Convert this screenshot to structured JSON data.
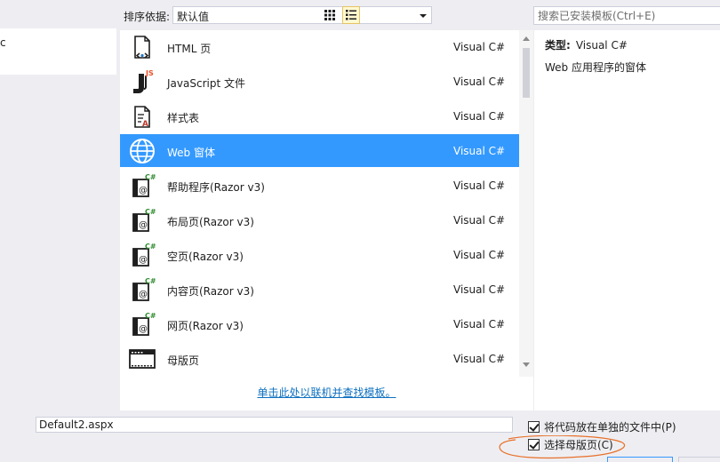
{
  "left_pane": {
    "selected_item_partial": "c"
  },
  "toolbar": {
    "sort_label": "排序依据:",
    "sort_value": "默认值",
    "search_placeholder": "搜索已安装模板(Ctrl+E)"
  },
  "templates": [
    {
      "name": "HTML 页",
      "type": "Visual C#",
      "icon": "html-page-icon"
    },
    {
      "name": "JavaScript 文件",
      "type": "Visual C#",
      "icon": "javascript-file-icon"
    },
    {
      "name": "样式表",
      "type": "Visual C#",
      "icon": "stylesheet-icon"
    },
    {
      "name": "Web 窗体",
      "type": "Visual C#",
      "icon": "web-form-globe-icon",
      "selected": true
    },
    {
      "name": "帮助程序(Razor v3)",
      "type": "Visual C#",
      "icon": "razor-csharp-icon"
    },
    {
      "name": "布局页(Razor v3)",
      "type": "Visual C#",
      "icon": "razor-csharp-icon"
    },
    {
      "name": "空页(Razor v3)",
      "type": "Visual C#",
      "icon": "razor-csharp-icon"
    },
    {
      "name": "内容页(Razor v3)",
      "type": "Visual C#",
      "icon": "razor-csharp-icon"
    },
    {
      "name": "网页(Razor v3)",
      "type": "Visual C#",
      "icon": "razor-csharp-icon"
    },
    {
      "name": "母版页",
      "type": "Visual C#",
      "icon": "master-page-icon"
    }
  ],
  "online_link": "单击此处以联机并查找模板。",
  "details": {
    "type_label": "类型:",
    "type_value": "Visual C#",
    "description": "Web 应用程序的窗体"
  },
  "bottom": {
    "file_name": "Default2.aspx",
    "checkbox_separate_code": {
      "label": "将代码放在单独的文件中(P)",
      "checked": true
    },
    "checkbox_master_page": {
      "label": "选择母版页(C)",
      "checked": true
    }
  },
  "colors": {
    "selection": "#3399ff",
    "link": "#0e70c0",
    "annotation": "#e8702a"
  }
}
